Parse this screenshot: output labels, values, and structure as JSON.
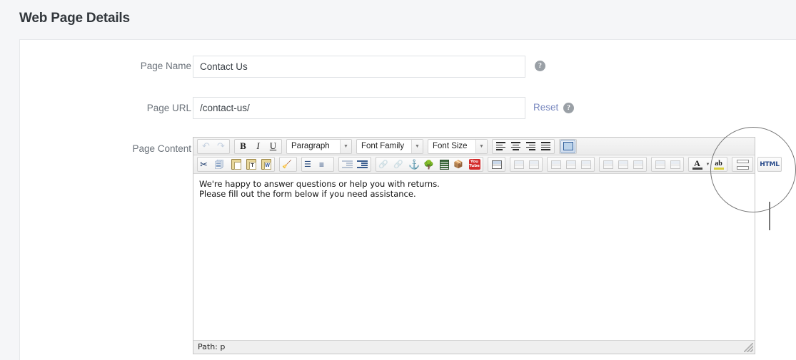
{
  "header": {
    "title": "Web Page Details"
  },
  "form": {
    "fields": [
      {
        "label": "Page Name",
        "value": "Contact Us",
        "help": "?"
      },
      {
        "label": "Page URL",
        "value": "/contact-us/",
        "help": "?",
        "reset_label": "Reset"
      },
      {
        "label": "Page Content"
      }
    ]
  },
  "editor": {
    "toolbar_row1": [
      {
        "name": "undo",
        "glyph": "↶",
        "state": "disabled"
      },
      {
        "name": "redo",
        "glyph": "↷",
        "state": "disabled"
      },
      {
        "name": "bold",
        "glyph": "B",
        "state": "enabled"
      },
      {
        "name": "italic",
        "glyph": "I",
        "state": "enabled"
      },
      {
        "name": "underline",
        "glyph": "U",
        "state": "enabled"
      },
      {
        "name": "format-select",
        "label": "Paragraph",
        "state": "enabled"
      },
      {
        "name": "font-family-select",
        "label": "Font Family",
        "state": "enabled"
      },
      {
        "name": "font-size-select",
        "label": "Font Size",
        "state": "enabled"
      },
      {
        "name": "align-left",
        "state": "enabled"
      },
      {
        "name": "align-center",
        "state": "enabled"
      },
      {
        "name": "align-right",
        "state": "enabled"
      },
      {
        "name": "align-justify",
        "state": "enabled"
      },
      {
        "name": "show-blocks",
        "state": "selected"
      }
    ],
    "toolbar_row2": [
      {
        "name": "cut",
        "state": "enabled"
      },
      {
        "name": "copy",
        "state": "enabled"
      },
      {
        "name": "paste",
        "state": "enabled"
      },
      {
        "name": "paste-as-text",
        "state": "enabled"
      },
      {
        "name": "paste-from-word",
        "state": "enabled"
      },
      {
        "name": "remove-formatting",
        "state": "enabled"
      },
      {
        "name": "bullet-list",
        "state": "enabled"
      },
      {
        "name": "numbered-list",
        "state": "enabled"
      },
      {
        "name": "outdent",
        "state": "disabled"
      },
      {
        "name": "indent",
        "state": "enabled"
      },
      {
        "name": "insert-link",
        "state": "disabled"
      },
      {
        "name": "unlink",
        "state": "disabled"
      },
      {
        "name": "anchor",
        "state": "enabled"
      },
      {
        "name": "insert-image",
        "state": "enabled"
      },
      {
        "name": "insert-media",
        "state": "enabled"
      },
      {
        "name": "insert-package",
        "state": "enabled"
      },
      {
        "name": "insert-youtube",
        "state": "enabled"
      },
      {
        "name": "insert-table",
        "state": "enabled"
      },
      {
        "name": "table-row-props",
        "state": "disabled"
      },
      {
        "name": "table-cell-props",
        "state": "disabled"
      },
      {
        "name": "insert-row-before",
        "state": "disabled"
      },
      {
        "name": "insert-row-after",
        "state": "disabled"
      },
      {
        "name": "delete-row",
        "state": "disabled"
      },
      {
        "name": "insert-col-before",
        "state": "disabled"
      },
      {
        "name": "insert-col-after",
        "state": "disabled"
      },
      {
        "name": "delete-col",
        "state": "disabled"
      },
      {
        "name": "split-cells",
        "state": "disabled"
      },
      {
        "name": "merge-cells",
        "state": "disabled"
      },
      {
        "name": "text-color",
        "state": "enabled"
      },
      {
        "name": "background-color",
        "state": "enabled"
      },
      {
        "name": "page-break",
        "state": "enabled"
      },
      {
        "name": "html-source",
        "label": "HTML",
        "state": "enabled"
      }
    ],
    "labels": {
      "paragraph": "Paragraph",
      "font_family": "Font Family",
      "font_size": "Font Size",
      "html": "HTML"
    },
    "content_line1": "We're happy to answer questions or help you with returns.",
    "content_line2": "Please fill out the form below if you need assistance.",
    "status_path": "Path: p"
  },
  "annotation": {
    "type": "magnifier-circle",
    "target": "html-source-button"
  },
  "colors": {
    "page_background": "#f5f6f8",
    "card_background": "#ffffff",
    "title_text": "#32373c",
    "label_text": "#6a7179",
    "link_blue": "#7b8ac0",
    "help_icon": "#9aa0a6",
    "input_border": "#dfe2e5",
    "editor_border": "#c5c5c5"
  }
}
